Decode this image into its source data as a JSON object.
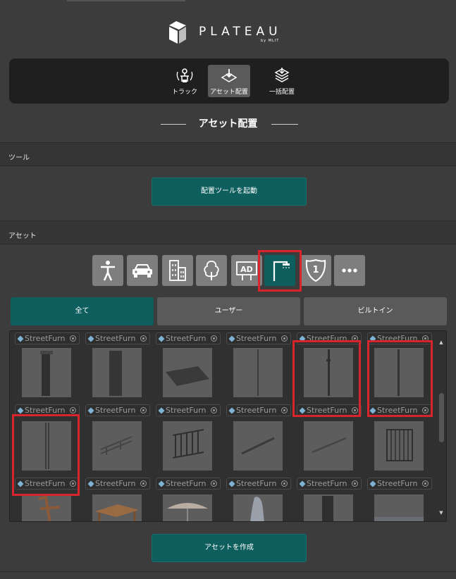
{
  "app": {
    "logo_text": "PLATEAU",
    "logo_sub": "by MLIT"
  },
  "modes": [
    {
      "label": "トラック",
      "icon": "track-icon",
      "active": false
    },
    {
      "label": "アセット配置",
      "icon": "asset-place-icon",
      "active": true
    },
    {
      "label": "一括配置",
      "icon": "bulk-place-icon",
      "active": false
    }
  ],
  "section_title": "アセット配置",
  "tool_header": "ツール",
  "launch_button": "配置ツールを起動",
  "asset_header": "アセット",
  "categories": [
    {
      "icon": "person-icon",
      "active": false
    },
    {
      "icon": "car-icon",
      "active": false
    },
    {
      "icon": "building-icon",
      "active": false
    },
    {
      "icon": "tree-icon",
      "active": false
    },
    {
      "icon": "ad-sign-icon",
      "label": "AD",
      "active": false
    },
    {
      "icon": "street-light-icon",
      "active": true
    },
    {
      "icon": "route-sign-icon",
      "label": "1",
      "active": false
    },
    {
      "icon": "more-icon",
      "active": false
    }
  ],
  "filter_tabs": [
    {
      "label": "全て",
      "active": true
    },
    {
      "label": "ユーザー",
      "active": false
    },
    {
      "label": "ビルトイン",
      "active": false
    }
  ],
  "asset_items": [
    {
      "name": "StreetFurn"
    },
    {
      "name": "StreetFurn"
    },
    {
      "name": "StreetFurn"
    },
    {
      "name": "StreetFurn"
    },
    {
      "name": "StreetFurn"
    },
    {
      "name": "StreetFurn"
    }
  ],
  "create_button": "アセットを作成",
  "colors": {
    "accent": "#0e5e5e",
    "highlight": "#d8242c",
    "background": "#3c3c3c"
  }
}
